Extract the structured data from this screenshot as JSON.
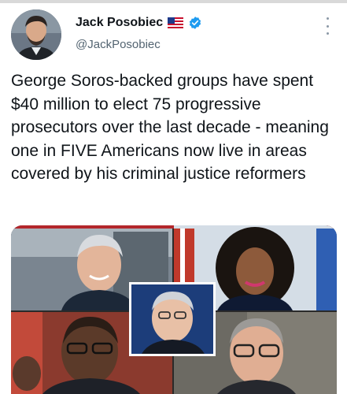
{
  "tweet": {
    "author_name": "Jack Posobiec",
    "author_handle": "@JackPosobiec",
    "flag_icon": "us-flag-icon",
    "verified_icon": "verified-badge-icon",
    "more_icon": "more-vertical-icon",
    "text": "George Soros-backed groups have spent $40 million to elect 75 progressive prosecutors over the last decade - meaning one in FIVE Americans now live in areas covered by his criminal justice reformers"
  },
  "colors": {
    "verified_blue": "#1d9bf0",
    "text_primary": "#0f1419",
    "text_secondary": "#536471"
  }
}
